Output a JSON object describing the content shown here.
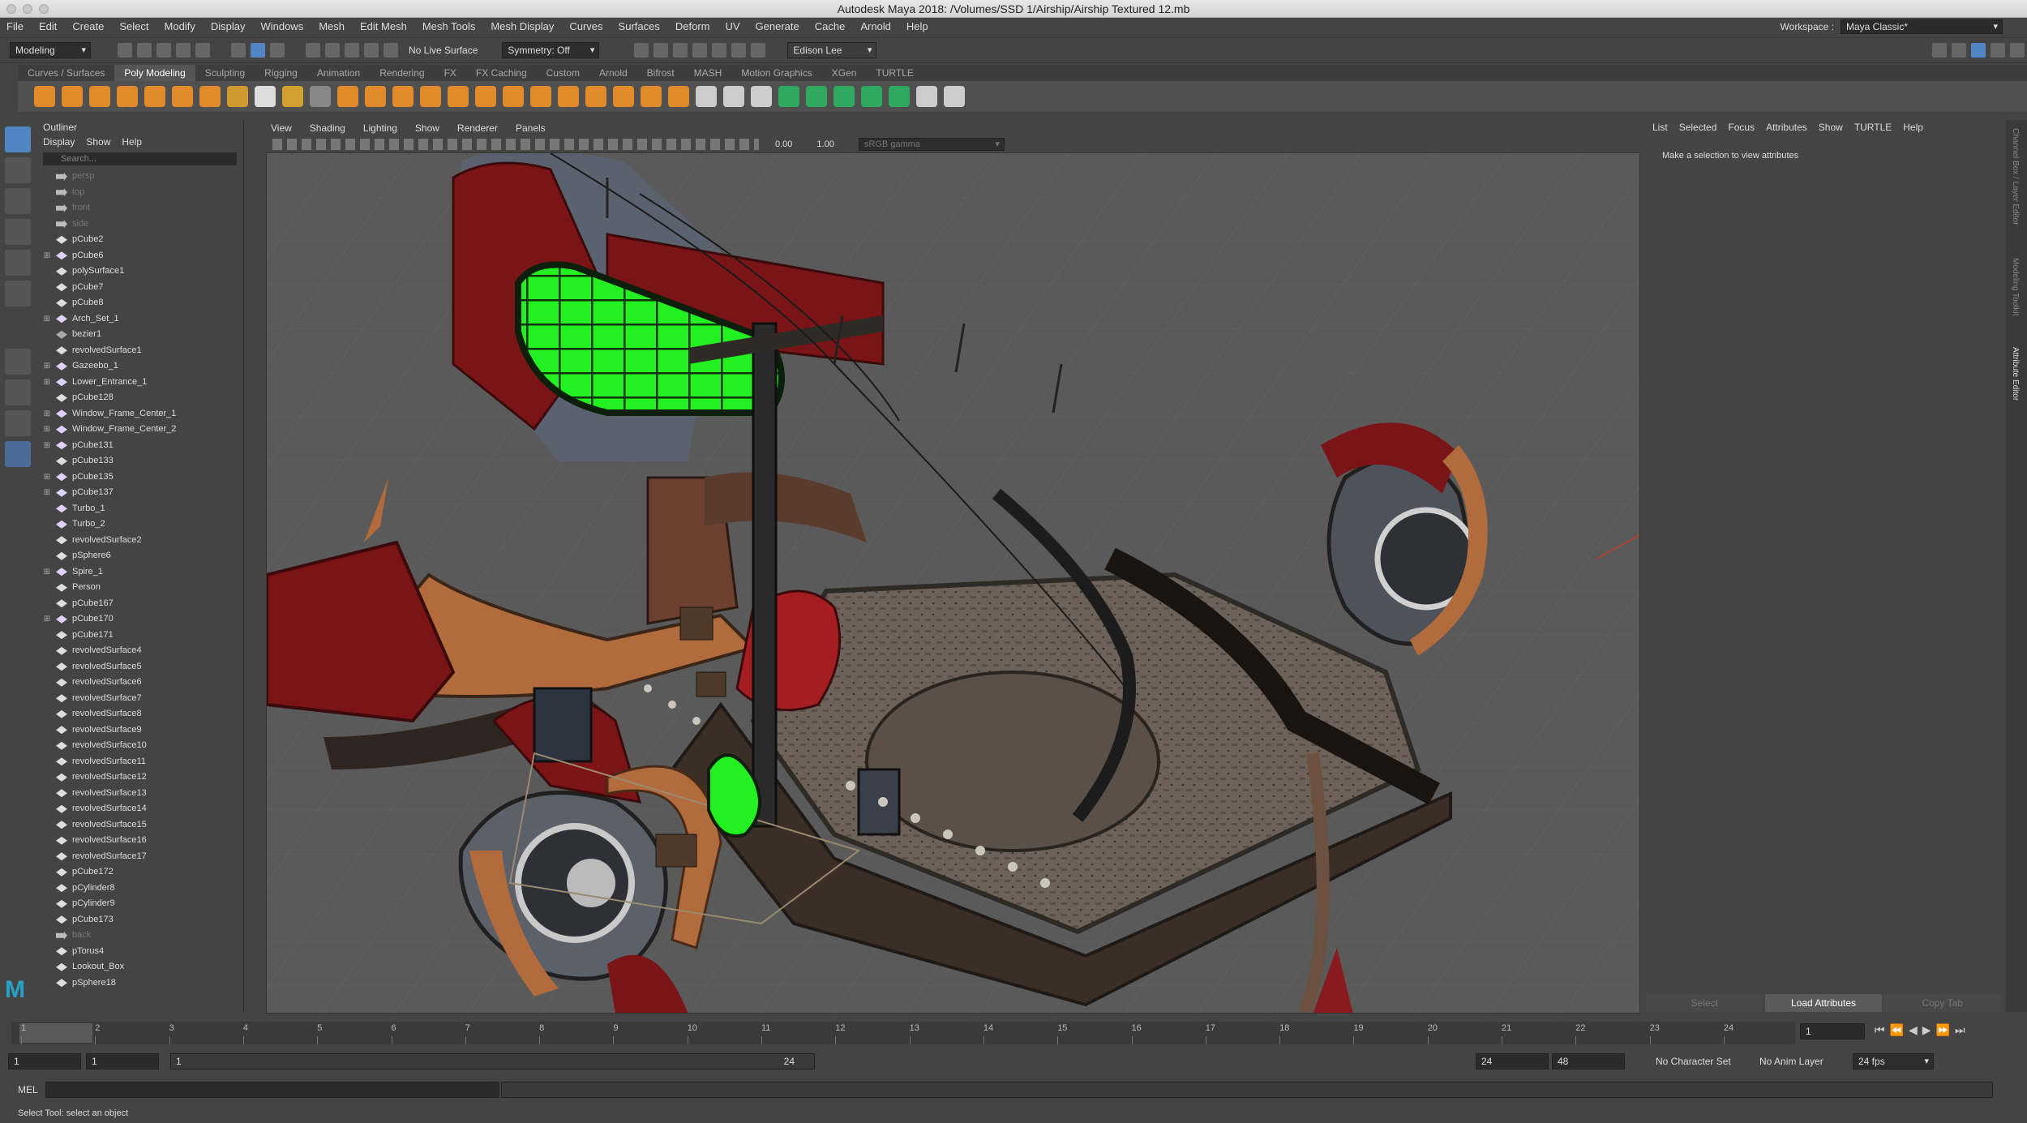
{
  "window": {
    "title": "Autodesk Maya 2018: /Volumes/SSD 1/Airship/Airship Textured 12.mb"
  },
  "menus": [
    "File",
    "Edit",
    "Create",
    "Select",
    "Modify",
    "Display",
    "Windows",
    "Mesh",
    "Edit Mesh",
    "Mesh Tools",
    "Mesh Display",
    "Curves",
    "Surfaces",
    "Deform",
    "UV",
    "Generate",
    "Cache",
    "Arnold",
    "Help"
  ],
  "workspace": {
    "label": "Workspace :",
    "value": "Maya Classic*"
  },
  "status": {
    "mode": "Modeling",
    "live_surface": "No Live Surface",
    "symmetry": "Symmetry: Off",
    "user": "Edison Lee"
  },
  "shelf_tabs": [
    "Curves / Surfaces",
    "Poly Modeling",
    "Sculpting",
    "Rigging",
    "Animation",
    "Rendering",
    "FX",
    "FX Caching",
    "Custom",
    "Arnold",
    "Bifrost",
    "MASH",
    "Motion Graphics",
    "XGen",
    "TURTLE"
  ],
  "shelf_active": "Poly Modeling",
  "outliner": {
    "title": "Outliner",
    "menu": [
      "Display",
      "Show",
      "Help"
    ],
    "search_placeholder": "Search...",
    "items": [
      {
        "name": "persp",
        "type": "camera",
        "dim": true
      },
      {
        "name": "top",
        "type": "camera",
        "dim": true
      },
      {
        "name": "front",
        "type": "camera",
        "dim": true
      },
      {
        "name": "side",
        "type": "camera",
        "dim": true
      },
      {
        "name": "pCube2",
        "type": "mesh"
      },
      {
        "name": "pCube6",
        "type": "group",
        "exp": true
      },
      {
        "name": "polySurface1",
        "type": "mesh"
      },
      {
        "name": "pCube7",
        "type": "mesh"
      },
      {
        "name": "pCube8",
        "type": "mesh"
      },
      {
        "name": "Arch_Set_1",
        "type": "group",
        "exp": true
      },
      {
        "name": "bezier1",
        "type": "curve"
      },
      {
        "name": "revolvedSurface1",
        "type": "mesh"
      },
      {
        "name": "Gazeebo_1",
        "type": "group",
        "exp": true
      },
      {
        "name": "Lower_Entrance_1",
        "type": "group",
        "exp": true
      },
      {
        "name": "pCube128",
        "type": "mesh"
      },
      {
        "name": "Window_Frame_Center_1",
        "type": "group",
        "exp": true
      },
      {
        "name": "Window_Frame_Center_2",
        "type": "group",
        "exp": true
      },
      {
        "name": "pCube131",
        "type": "group",
        "exp": true
      },
      {
        "name": "pCube133",
        "type": "mesh"
      },
      {
        "name": "pCube135",
        "type": "group",
        "exp": true
      },
      {
        "name": "pCube137",
        "type": "group",
        "exp": true
      },
      {
        "name": "Turbo_1",
        "type": "group"
      },
      {
        "name": "Turbo_2",
        "type": "group"
      },
      {
        "name": "revolvedSurface2",
        "type": "mesh"
      },
      {
        "name": "pSphere6",
        "type": "mesh"
      },
      {
        "name": "Spire_1",
        "type": "group",
        "exp": true
      },
      {
        "name": "Person",
        "type": "mesh"
      },
      {
        "name": "pCube167",
        "type": "mesh"
      },
      {
        "name": "pCube170",
        "type": "group",
        "exp": true
      },
      {
        "name": "pCube171",
        "type": "mesh"
      },
      {
        "name": "revolvedSurface4",
        "type": "mesh"
      },
      {
        "name": "revolvedSurface5",
        "type": "mesh"
      },
      {
        "name": "revolvedSurface6",
        "type": "mesh"
      },
      {
        "name": "revolvedSurface7",
        "type": "mesh"
      },
      {
        "name": "revolvedSurface8",
        "type": "mesh"
      },
      {
        "name": "revolvedSurface9",
        "type": "mesh"
      },
      {
        "name": "revolvedSurface10",
        "type": "mesh"
      },
      {
        "name": "revolvedSurface11",
        "type": "mesh"
      },
      {
        "name": "revolvedSurface12",
        "type": "mesh"
      },
      {
        "name": "revolvedSurface13",
        "type": "mesh"
      },
      {
        "name": "revolvedSurface14",
        "type": "mesh"
      },
      {
        "name": "revolvedSurface15",
        "type": "mesh"
      },
      {
        "name": "revolvedSurface16",
        "type": "mesh"
      },
      {
        "name": "revolvedSurface17",
        "type": "mesh"
      },
      {
        "name": "pCube172",
        "type": "mesh"
      },
      {
        "name": "pCylinder8",
        "type": "mesh"
      },
      {
        "name": "pCylinder9",
        "type": "mesh"
      },
      {
        "name": "pCube173",
        "type": "mesh"
      },
      {
        "name": "back",
        "type": "camera",
        "dim": true
      },
      {
        "name": "pTorus4",
        "type": "mesh"
      },
      {
        "name": "Lookout_Box",
        "type": "mesh"
      },
      {
        "name": "pSphere18",
        "type": "mesh"
      }
    ]
  },
  "viewport": {
    "menu": [
      "View",
      "Shading",
      "Lighting",
      "Show",
      "Renderer",
      "Panels"
    ],
    "exposure": "0.00",
    "gamma": "1.00",
    "colorspace": "sRGB gamma"
  },
  "attr_editor": {
    "menu": [
      "List",
      "Selected",
      "Focus",
      "Attributes",
      "Show",
      "TURTLE",
      "Help"
    ],
    "message": "Make a selection to view attributes",
    "buttons": [
      "Select",
      "Load Attributes",
      "Copy Tab"
    ]
  },
  "side_tabs": [
    "Channel Box / Layer Editor",
    "Modeling Toolkit",
    "Attribute Editor"
  ],
  "timeline": {
    "ticks": [
      "1",
      "2",
      "3",
      "4",
      "5",
      "6",
      "7",
      "8",
      "9",
      "10",
      "11",
      "12",
      "13",
      "14",
      "15",
      "16",
      "17",
      "18",
      "19",
      "20",
      "21",
      "22",
      "23",
      "24"
    ],
    "current": "1",
    "current_frame_field": "1"
  },
  "range": {
    "start": "1",
    "anim_start": "1",
    "slider_start": "1",
    "slider_end": "24",
    "end": "24",
    "anim_end": "48",
    "character": "No Character Set",
    "anim_layer": "No Anim Layer",
    "fps": "24 fps"
  },
  "command": {
    "label": "MEL"
  },
  "help_line": "Select Tool: select an object",
  "colors": {
    "accent": "#5285c4",
    "highlight_green": "#22f020",
    "hull_red": "#7a1417",
    "copper": "#b26b3c"
  }
}
